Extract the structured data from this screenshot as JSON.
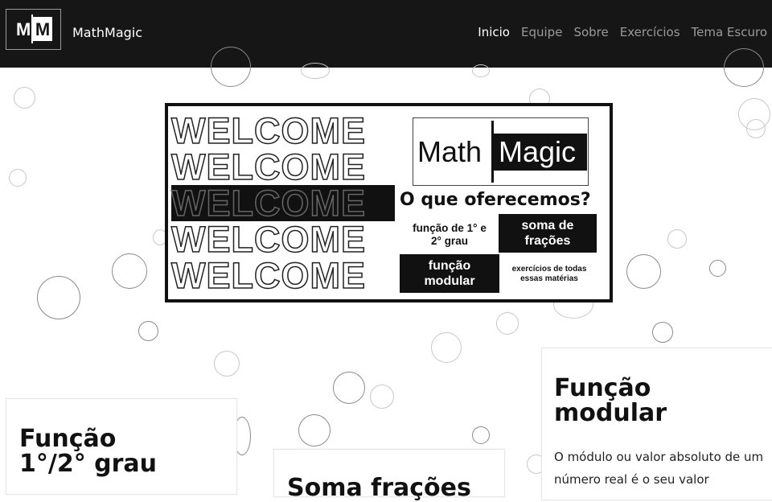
{
  "nav": {
    "logo_left": "M",
    "logo_right": "M",
    "brand": "MathMagic",
    "links": [
      "Inicio",
      "Equipe",
      "Sobre",
      "Exercícios",
      "Tema Escuro"
    ]
  },
  "banner": {
    "welcome": [
      "WELCOME",
      "WELCOME",
      "WELCOME",
      "WELCOME",
      "WELCOME"
    ],
    "logo_math": "Math",
    "logo_magic": "Magic",
    "offer_title": "O que oferecemos?",
    "cells": {
      "funcao_grau": "função de 1° e 2° grau",
      "soma_fracoes": "soma de frações",
      "funcao_modular": "função modular",
      "exercicios": "exercícios de todas essas matérias"
    }
  },
  "cards": {
    "card1_title": "Função 1°/2° grau",
    "card2_title": "Soma frações",
    "card3_title": "Função modular",
    "card3_text": "O módulo ou valor absoluto de um número real é o seu valor"
  },
  "colors": {
    "nav_bg": "#161616",
    "accent": "#111111",
    "muted_link": "#9a9a9a"
  }
}
